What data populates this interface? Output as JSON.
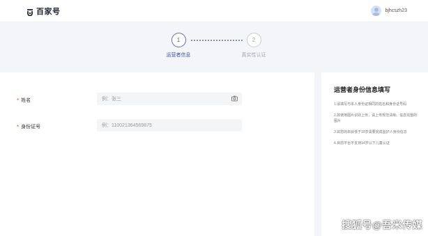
{
  "header": {
    "logo_text": "百家号",
    "logo_icon": "baijiahao-logo-icon",
    "username": "bjhcszh23",
    "avatar_icon": "user-avatar-icon"
  },
  "steps": [
    {
      "number": "1",
      "label": "运营者信息",
      "state": "active"
    },
    {
      "number": "2",
      "label": "真实性认证",
      "state": "inactive"
    }
  ],
  "form": {
    "name_field": {
      "required_mark": "*",
      "label": "姓名",
      "placeholder": "例：张三",
      "icon": "camera-icon"
    },
    "id_field": {
      "required_mark": "*",
      "label": "身份证号",
      "placeholder": "例：110021364569875"
    }
  },
  "sidebar": {
    "title": "运营者身份信息填写",
    "items": [
      "1.请填写与本人身份证相同的姓名和身份证号码",
      "2.如使用图片识别上传，请上传规范清晰、信息完整的图片",
      "3.如您的年龄低于18岁需要完成监护人身份信息",
      "4.目前平台不支持14岁以下儿童认证"
    ]
  },
  "watermark": "搜狐号@吾米传媒",
  "colors": {
    "accent": "#3d55a8",
    "background": "#f3f5f8",
    "required": "#e0573a"
  }
}
